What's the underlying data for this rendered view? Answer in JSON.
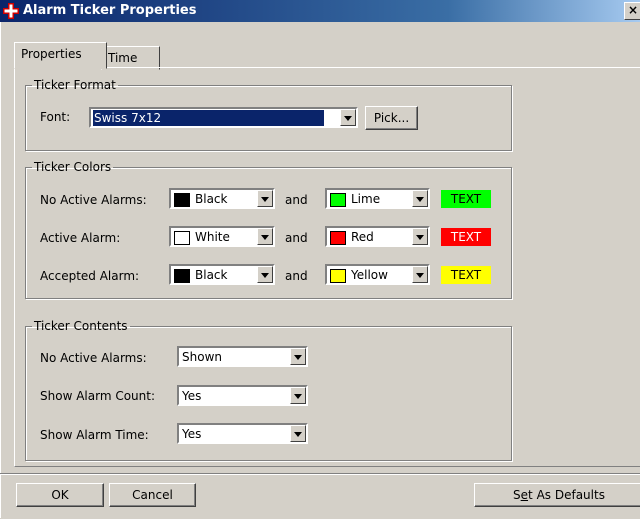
{
  "window": {
    "title": "Alarm Ticker Properties",
    "close_glyph": "×"
  },
  "tabs": [
    {
      "label": "Properties",
      "active": true
    },
    {
      "label": "Time",
      "active": false
    }
  ],
  "ticker_format": {
    "legend": "Ticker Format",
    "font_label": "Font:",
    "font_value": "Swiss 7x12",
    "pick_button": "Pick..."
  },
  "ticker_colors": {
    "legend": "Ticker Colors",
    "and_label": "and",
    "rows": [
      {
        "label": "No Active Alarms:",
        "color1": {
          "name": "Black",
          "hex": "#000000"
        },
        "color2": {
          "name": "Lime",
          "hex": "#00ff00"
        },
        "sample": {
          "text": "TEXT",
          "bg": "#00ff00",
          "fg": "#000000"
        }
      },
      {
        "label": "Active Alarm:",
        "color1": {
          "name": "White",
          "hex": "#ffffff"
        },
        "color2": {
          "name": "Red",
          "hex": "#ff0000"
        },
        "sample": {
          "text": "TEXT",
          "bg": "#ff0000",
          "fg": "#ffffff"
        }
      },
      {
        "label": "Accepted Alarm:",
        "color1": {
          "name": "Black",
          "hex": "#000000"
        },
        "color2": {
          "name": "Yellow",
          "hex": "#ffff00"
        },
        "sample": {
          "text": "TEXT",
          "bg": "#ffff00",
          "fg": "#000000"
        }
      }
    ]
  },
  "ticker_contents": {
    "legend": "Ticker Contents",
    "rows": [
      {
        "label": "No Active Alarms:",
        "value": "Shown"
      },
      {
        "label": "Show Alarm Count:",
        "value": "Yes"
      },
      {
        "label": "Show Alarm Time:",
        "value": "Yes"
      }
    ]
  },
  "buttons": {
    "ok": "OK",
    "cancel": "Cancel",
    "set_defaults_pre": "S",
    "set_defaults_ul": "e",
    "set_defaults_post": "t As Defaults"
  },
  "colors": {
    "titlebar_start": "#0a246a",
    "titlebar_end": "#a6caf0",
    "dialog_bg": "#d4d0c8",
    "selection": "#0a246a"
  },
  "icons": {
    "app": "alarm-ticker-app-icon",
    "close": "close-icon",
    "dropdown": "chevron-down-icon"
  }
}
